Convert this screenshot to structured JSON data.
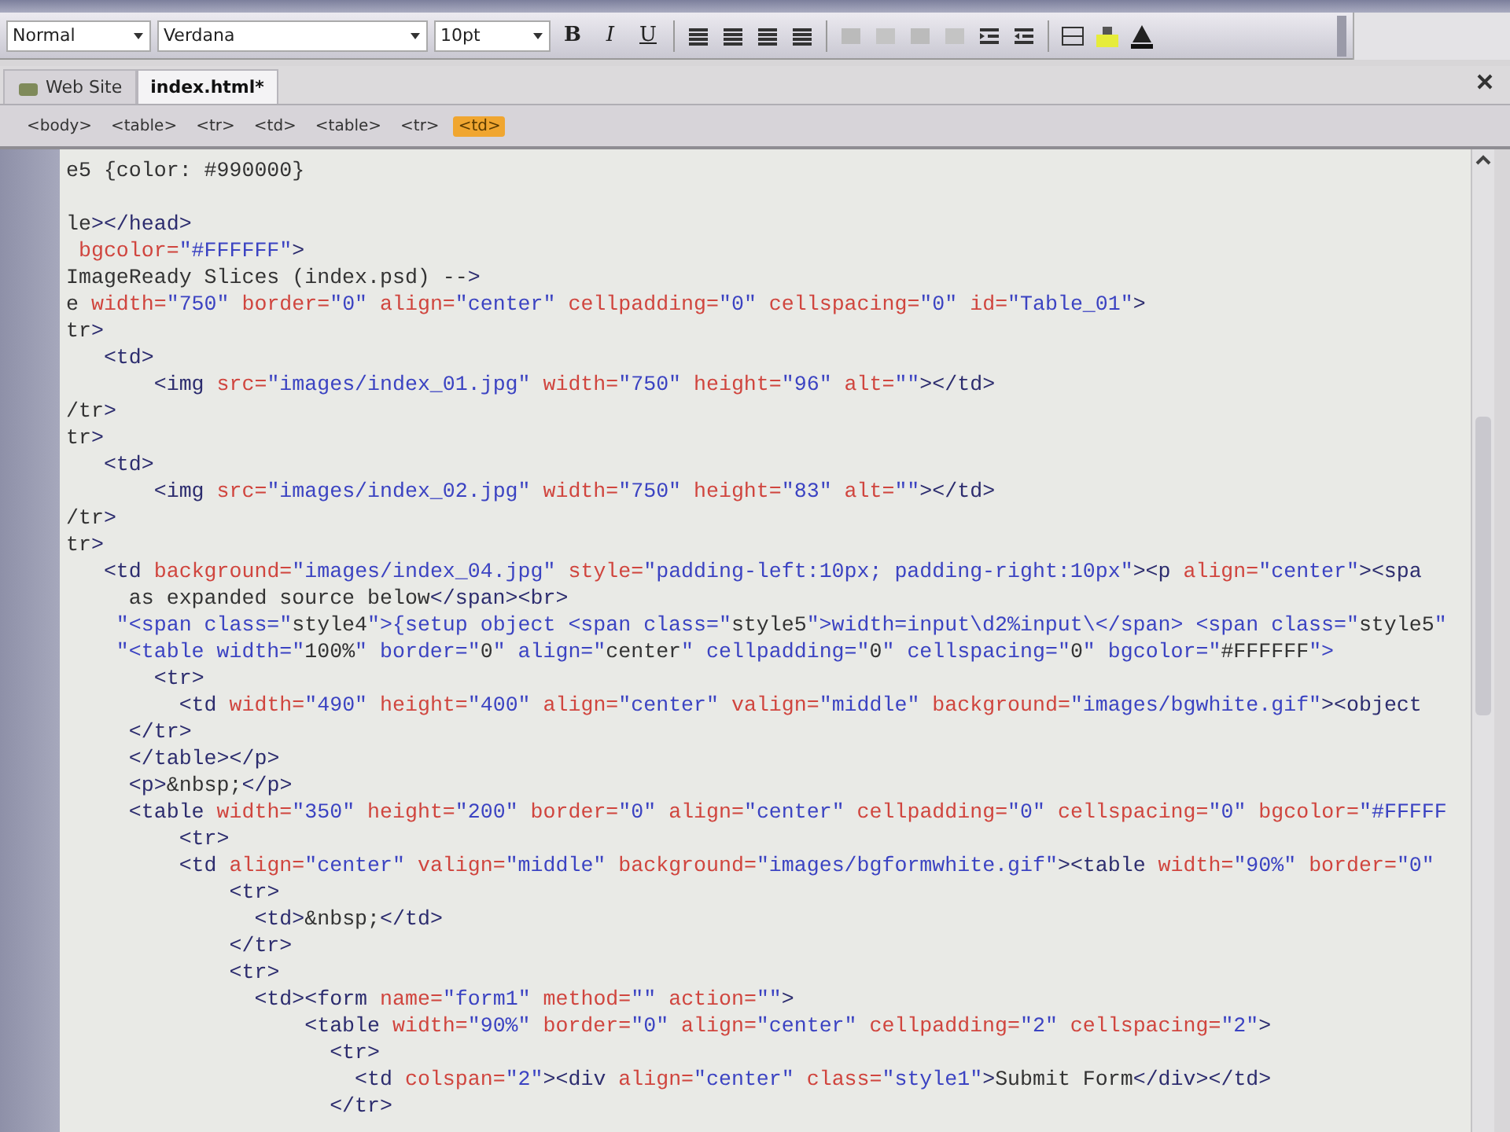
{
  "toolbar": {
    "format": "Normal",
    "font": "Verdana",
    "size": "10pt",
    "style_buttons": [
      "B",
      "I",
      "U"
    ]
  },
  "tabs": [
    {
      "label": "Web Site",
      "selected": false
    },
    {
      "label": "index.html*",
      "selected": true
    }
  ],
  "tag_selector": [
    {
      "label": "<body>",
      "selected": false
    },
    {
      "label": "<table>",
      "selected": false
    },
    {
      "label": "<tr>",
      "selected": false
    },
    {
      "label": "<td>",
      "selected": false
    },
    {
      "label": "<table>",
      "selected": false
    },
    {
      "label": "<tr>",
      "selected": false
    },
    {
      "label": "<td>",
      "selected": true
    }
  ],
  "style_lines": [
    "e5 {color: #990000}"
  ],
  "code_lines": [
    "le></head>",
    " bgcolor=\"#FFFFFF\">",
    "ImageReady Slices (index.psd) -->",
    "e width=\"750\" border=\"0\" align=\"center\" cellpadding=\"0\" cellspacing=\"0\" id=\"Table_01\">",
    "tr>",
    "   <td>",
    "       <img src=\"images/index_01.jpg\" width=\"750\" height=\"96\" alt=\"\"></td>",
    "/tr>",
    "tr>",
    "   <td>",
    "       <img src=\"images/index_02.jpg\" width=\"750\" height=\"83\" alt=\"\"></td>",
    "/tr>",
    "tr>",
    "   <td background=\"images/index_04.jpg\" style=\"padding-left:10px; padding-right:10px\"><p align=\"center\"><spa",
    "     as expanded source below</span><br>",
    "    \"<span class=\"style4\">{setup object <span class=\"style5\">width=input\\d2%input\\</span> <span class=\"style5\"",
    "    \"<table width=\"100%\" border=\"0\" align=\"center\" cellpadding=\"0\" cellspacing=\"0\" bgcolor=\"#FFFFFF\">",
    "       <tr>",
    "         <td width=\"490\" height=\"400\" align=\"center\" valign=\"middle\" background=\"images/bgwhite.gif\"><object",
    "     </tr>",
    "     </table></p>",
    "     <p>&nbsp;</p>",
    "     <table width=\"350\" height=\"200\" border=\"0\" align=\"center\" cellpadding=\"0\" cellspacing=\"0\" bgcolor=\"#FFFFF",
    "         <tr>",
    "         <td align=\"center\" valign=\"middle\" background=\"images/bgformwhite.gif\"><table width=\"90%\" border=\"0\"",
    "             <tr>",
    "               <td>&nbsp;</td>",
    "             </tr>",
    "             <tr>",
    "               <td><form name=\"form1\" method=\"\" action=\"\">",
    "                   <table width=\"90%\" border=\"0\" align=\"center\" cellpadding=\"2\" cellspacing=\"2\">",
    "                     <tr>",
    "                       <td colspan=\"2\"><div align=\"center\" class=\"style1\">Submit Form</div></td>",
    "                     </tr>"
  ]
}
